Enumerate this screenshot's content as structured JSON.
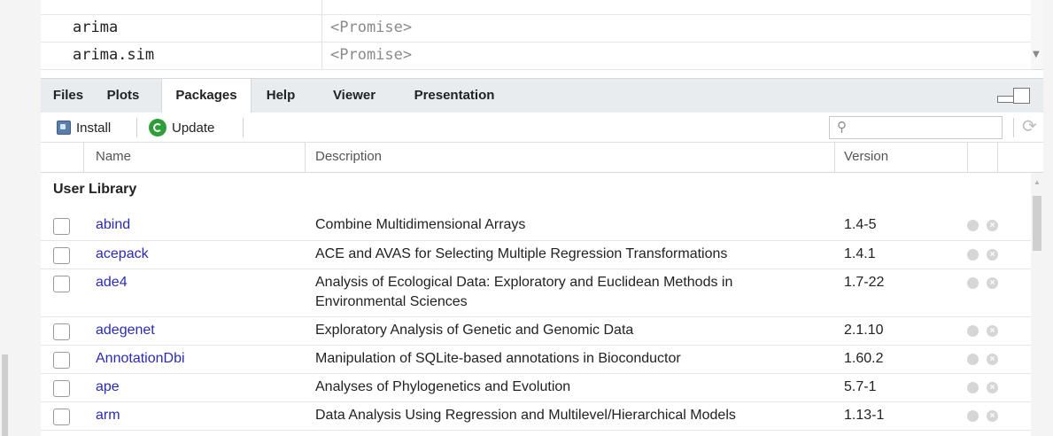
{
  "environment": {
    "rows": [
      {
        "name": "arima",
        "value": "<Promise>"
      },
      {
        "name": "arima.sim",
        "value": "<Promise>"
      }
    ]
  },
  "tabs": [
    {
      "label": "Files"
    },
    {
      "label": "Plots"
    },
    {
      "label": "Packages",
      "active": true
    },
    {
      "label": "Help"
    },
    {
      "label": "Viewer"
    },
    {
      "label": "Presentation"
    }
  ],
  "toolbar": {
    "install_label": "Install",
    "update_label": "Update",
    "search_placeholder": ""
  },
  "table": {
    "columns": {
      "name": "Name",
      "description": "Description",
      "version": "Version"
    },
    "section_title": "User Library",
    "rows": [
      {
        "name": "abind",
        "description": "Combine Multidimensional Arrays",
        "version": "1.4-5"
      },
      {
        "name": "acepack",
        "description": "ACE and AVAS for Selecting Multiple Regression Transformations",
        "version": "1.4.1"
      },
      {
        "name": "ade4",
        "description": "Analysis of Ecological Data: Exploratory and Euclidean Methods in Environmental Sciences",
        "version": "1.7-22"
      },
      {
        "name": "adegenet",
        "description": "Exploratory Analysis of Genetic and Genomic Data",
        "version": "2.1.10"
      },
      {
        "name": "AnnotationDbi",
        "description": "Manipulation of SQLite-based annotations in Bioconductor",
        "version": "1.60.2"
      },
      {
        "name": "ape",
        "description": "Analyses of Phylogenetics and Evolution",
        "version": "5.7-1"
      },
      {
        "name": "arm",
        "description": "Data Analysis Using Regression and Multilevel/Hierarchical Models",
        "version": "1.13-1"
      }
    ]
  },
  "colors": {
    "package_link": "#2a2ab5",
    "update_icon": "#2f9e3a",
    "tab_bar": "#e9ecef"
  }
}
